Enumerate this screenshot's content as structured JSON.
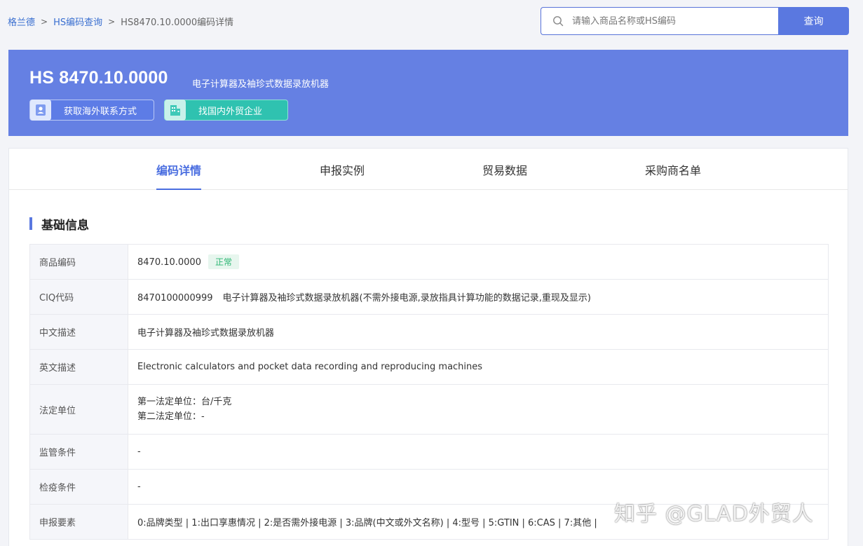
{
  "breadcrumb": {
    "home": "格兰德",
    "query": "HS编码查询",
    "current": "HS8470.10.0000编码详情",
    "separator": ">"
  },
  "search": {
    "placeholder": "请输入商品名称或HS编码",
    "button_label": "查询",
    "icon": "search-icon"
  },
  "hero": {
    "hs_code": "HS 8470.10.0000",
    "name": "电子计算器及袖珍式数据录放机器",
    "btn_contact": "获取海外联系方式",
    "btn_company": "找国内外贸企业"
  },
  "tabs": [
    {
      "label": "编码详情",
      "active": true
    },
    {
      "label": "申报实例",
      "active": false
    },
    {
      "label": "贸易数据",
      "active": false
    },
    {
      "label": "采购商名单",
      "active": false
    }
  ],
  "section": {
    "title": "基础信息"
  },
  "details": {
    "code_label": "商品编码",
    "code_value": "8470.10.0000",
    "status": "正常",
    "ciq_label": "CIQ代码",
    "ciq_code": "8470100000999",
    "ciq_desc": "电子计算器及袖珍式数据录放机器(不需外接电源,录放指具计算功能的数据记录,重现及显示)",
    "cn_label": "中文描述",
    "cn_value": "电子计算器及袖珍式数据录放机器",
    "en_label": "英文描述",
    "en_value": "Electronic calculators and pocket data recording and reproducing machines",
    "unit_label": "法定单位",
    "unit_first": "第一法定单位：台/千克",
    "unit_second": "第二法定单位：-",
    "supervision_label": "监管条件",
    "supervision_value": "-",
    "quarantine_label": "检疫条件",
    "quarantine_value": "-",
    "declare_label": "申报要素",
    "declare_value": "0:品牌类型 | 1:出口享惠情况 | 2:是否需外接电源 | 3:品牌(中文或外文名称) | 4:型号 | 5:GTIN | 6:CAS | 7:其他 |"
  },
  "watermark": "知乎 @GLAD外贸人",
  "colors": {
    "hero_bg": "#6580e3",
    "accent": "#4a6ee0",
    "teal": "#2fc2b0",
    "status_green": "#2bb673"
  }
}
